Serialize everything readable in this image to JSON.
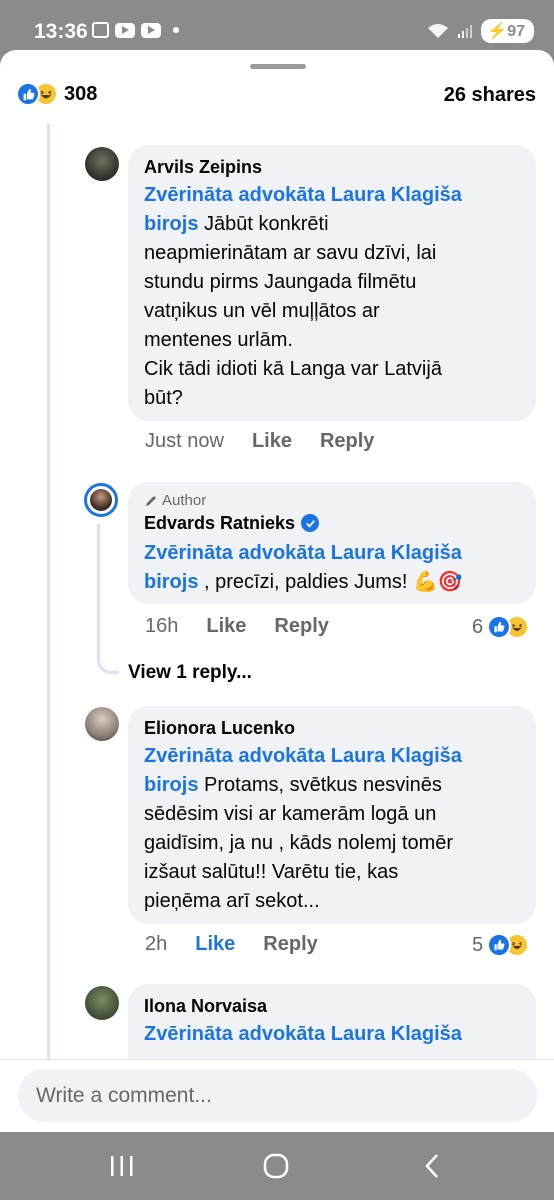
{
  "status_bar": {
    "time": "13:36",
    "battery": "97"
  },
  "post_summary": {
    "reaction_count": "308",
    "shares": "26 shares"
  },
  "comments": [
    {
      "author": "Arvils Zeipins",
      "mention": "Zvērināta advokāta Laura Klagiša birojs",
      "text_lines": [
        "Jābūt konkrēti",
        "neapmierinātam ar savu dzīvi,  lai",
        "stundu pirms Jaungada filmētu",
        "vatņikus un vēl muļļātos ar",
        "mentenes urlām.",
        "Cik tādi idioti kā Langa var Latvijā",
        "būt?"
      ],
      "mention_line1": "Zvērināta advokāta Laura Klagiša",
      "mention_line2": "birojs",
      "time": "Just now",
      "like": "Like",
      "reply": "Reply"
    },
    {
      "author_tag": "Author",
      "author": "Edvards Ratnieks",
      "mention_line1": "Zvērināta advokāta Laura Klagiša",
      "mention_line2": "birojs",
      "text": " , precīzi, paldies Jums! 💪🎯",
      "time": "16h",
      "like": "Like",
      "reply": "Reply",
      "reactions": "6"
    },
    {
      "author": "Elionora Lucenko",
      "mention_line1": "Zvērināta advokāta Laura Klagiša",
      "mention_line2": "birojs",
      "text_first": " Protams, svētkus nesvinēs",
      "text_lines": [
        "sēdēsim visi ar kamerām logā un",
        "gaidīsim, ja nu , kāds nolemj tomēr",
        "izšaut salūtu!! Varētu tie, kas",
        "pieņēma arī sekot..."
      ],
      "time": "2h",
      "like": "Like",
      "reply": "Reply",
      "reactions": "5"
    },
    {
      "author": "Ilona Norvaisa",
      "mention_line1": "Zvērināta advokāta Laura Klagiša"
    }
  ],
  "view_replies": "View 1 reply...",
  "composer": {
    "placeholder": "Write a comment..."
  },
  "colors": {
    "accent": "#1b74e4",
    "bubble": "#f0f2f5",
    "secondary_text": "#65676b",
    "haha": "#f7c531"
  },
  "icons": [
    "like-reaction-icon",
    "haha-reaction-icon",
    "verified-badge-icon",
    "pencil-icon",
    "recent-apps-icon",
    "home-icon",
    "back-icon"
  ]
}
